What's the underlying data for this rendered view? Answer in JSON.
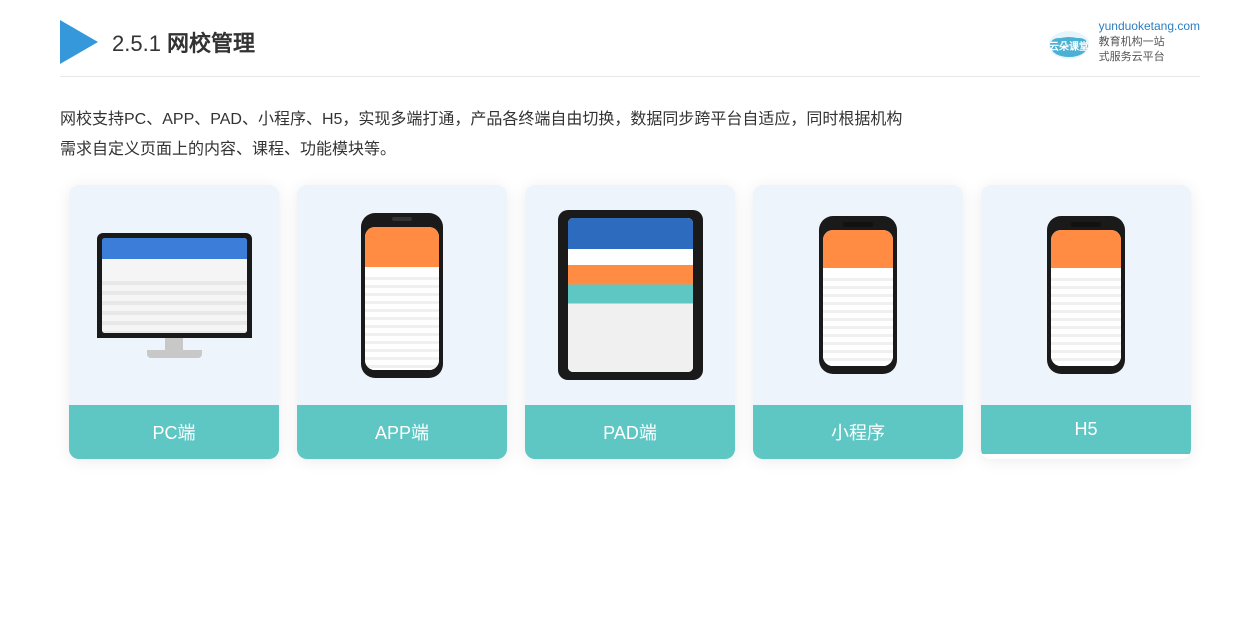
{
  "header": {
    "title_prefix": "2.5.1 ",
    "title_main": "网校管理",
    "brand": {
      "site": "yunduoketang.com",
      "tagline_line1": "教育机构一站",
      "tagline_line2": "式服务云平台"
    }
  },
  "body_text_line1": "网校支持PC、APP、PAD、小程序、H5，实现多端打通，产品各终端自由切换，数据同步跨平台自适应，同时根据机构",
  "body_text_line2": "需求自定义页面上的内容、课程、功能模块等。",
  "cards": [
    {
      "id": "pc",
      "label": "PC端",
      "type": "pc"
    },
    {
      "id": "app",
      "label": "APP端",
      "type": "phone"
    },
    {
      "id": "pad",
      "label": "PAD端",
      "type": "tablet"
    },
    {
      "id": "miniprogram",
      "label": "小程序",
      "type": "phone"
    },
    {
      "id": "h5",
      "label": "H5",
      "type": "phone"
    }
  ]
}
